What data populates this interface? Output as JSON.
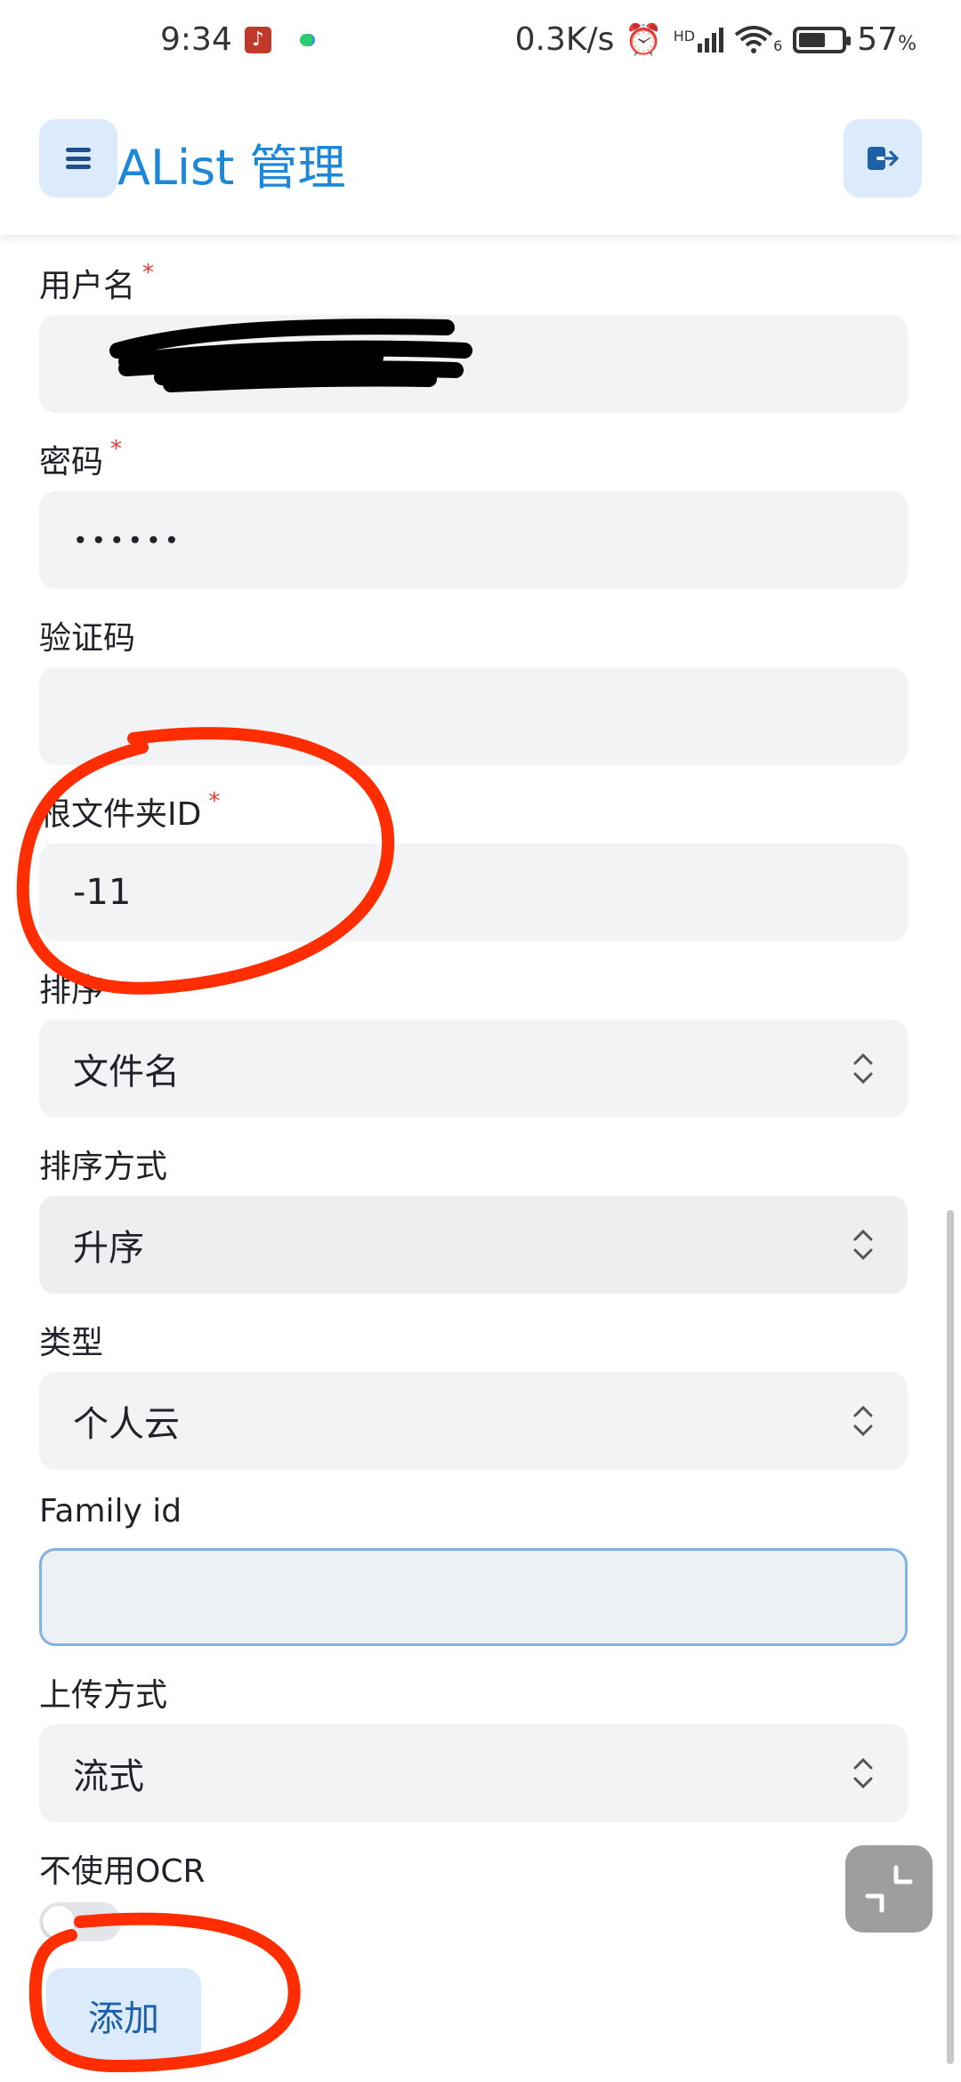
{
  "status_bar": {
    "time": "9:34",
    "net_speed": "0.3K/s",
    "signal_label": "HD",
    "wifi_sub": "6",
    "battery_pct": "57",
    "battery_unit": "%"
  },
  "header": {
    "title": "AList 管理"
  },
  "form": {
    "username": {
      "label": "用户名",
      "required": "*"
    },
    "password": {
      "label": "密码",
      "required": "*",
      "value": "••••••"
    },
    "captcha": {
      "label": "验证码",
      "value": ""
    },
    "root_folder": {
      "label": "根文件夹ID",
      "required": "*",
      "value": "-11"
    },
    "order_by": {
      "label": "排序",
      "value": "文件名"
    },
    "order_direction": {
      "label": "排序方式",
      "value": "升序"
    },
    "type": {
      "label": "类型",
      "value": "个人云"
    },
    "family_id": {
      "label": "Family id",
      "value": ""
    },
    "upload_method": {
      "label": "上传方式",
      "value": "流式"
    },
    "no_ocr": {
      "label": "不使用OCR",
      "enabled": false
    },
    "add_label": "添加"
  },
  "colors": {
    "accent": "#1e88d8",
    "button_bg": "#dcebfb",
    "required": "#e53935",
    "annotation": "#ff2d00"
  }
}
